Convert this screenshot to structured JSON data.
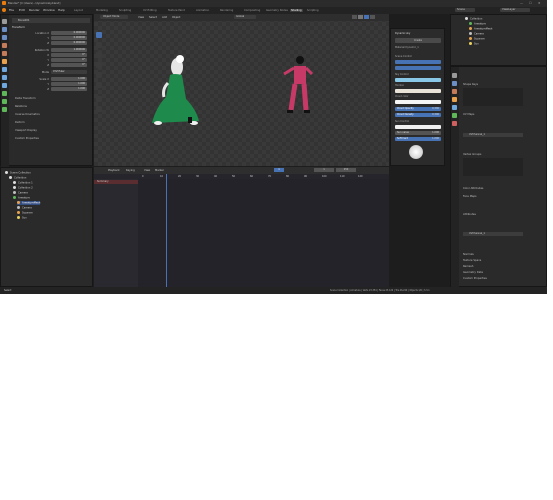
{
  "window": {
    "title": "Blender* [C:\\Users\\...\\dynamicsky.blend]",
    "controls": [
      "—",
      "☐",
      "✕"
    ]
  },
  "menubar": {
    "items": [
      "File",
      "Edit",
      "Render",
      "Window",
      "Help"
    ],
    "workspaces": [
      "Layout",
      "Modeling",
      "Sculpting",
      "UV Editing",
      "Texture Paint",
      "Shading",
      "Animation",
      "Rendering",
      "Compositing",
      "Geometry Nodes",
      "Scripting"
    ],
    "active_workspace": "Shading",
    "scene": "Scene",
    "view_layer": "ViewLayer"
  },
  "left_panel": {
    "object_name": "Bone001",
    "section_transform": "Transform",
    "rows": [
      {
        "label": "Location X",
        "value": "0.000000"
      },
      {
        "label": "Y",
        "value": "0.000000"
      },
      {
        "label": "Z",
        "value": "0.000000"
      },
      {
        "label": "Rotation W",
        "value": "1.000000"
      },
      {
        "label": "X",
        "value": "0°"
      },
      {
        "label": "Y",
        "value": "0°"
      },
      {
        "label": "Z",
        "value": "0°"
      },
      {
        "label": "Mode",
        "value": "XYZ Euler"
      },
      {
        "label": "Scale X",
        "value": "1.000"
      },
      {
        "label": "Y",
        "value": "1.000"
      },
      {
        "label": "Z",
        "value": "1.000"
      }
    ],
    "sections": [
      "Delta Transform",
      "Relations",
      "Inverse Kinematics",
      "Deform",
      "Viewport Display",
      "Custom Properties"
    ]
  },
  "viewport": {
    "mode": "Object Mode",
    "menus": [
      "View",
      "Select",
      "Add",
      "Object"
    ],
    "shading_label": "Global"
  },
  "dynamic_sky_panel": {
    "title": "Dynamic sky",
    "create_button": "Create",
    "material": "Material Dynamic_1",
    "labels": [
      "Scene Control",
      "Sky Control",
      "Horizon",
      "Cloud color",
      "Cloud Opacity",
      "Cloud Density",
      "Sun Control",
      "Sun value",
      "Soft hard"
    ],
    "values": {
      "cloud_opacity": "0.300",
      "cloud_density": "0.300",
      "sun_value": "1.000",
      "soft_hard": "1.000"
    }
  },
  "outliner": {
    "title": "Scene Collection",
    "items": [
      "Collection",
      "Collection 1",
      "Collection 2",
      "Camera",
      "Armature",
      "ArmatureMesh",
      "Camera",
      "Suzanne",
      "Sun"
    ]
  },
  "timeline": {
    "menus": [
      "Playback",
      "Keying",
      "View",
      "Marker"
    ],
    "current_frame": "1",
    "start": "1",
    "end": "250",
    "track_label": "Summary",
    "ruler": [
      "0",
      "10",
      "20",
      "30",
      "40",
      "50",
      "60",
      "70",
      "80",
      "90",
      "100",
      "110",
      "120"
    ]
  },
  "properties": {
    "sections": [
      "Shape Keys",
      "UV Maps",
      "Vertex Groups",
      "Color Attributes",
      "Face Maps",
      "Attributes",
      "Normals",
      "Texture Space",
      "Remesh",
      "Geometry Data",
      "Custom Properties"
    ],
    "uv_map": "UVChannel_1",
    "color_attr": "UVChannel_1"
  },
  "statusbar": {
    "left": "Select",
    "right": "Scene Collection | Armature | Verts 23,354 | Faces 23,120 | Tris 46,240 | Objects 1/6 | 3.3.1"
  }
}
